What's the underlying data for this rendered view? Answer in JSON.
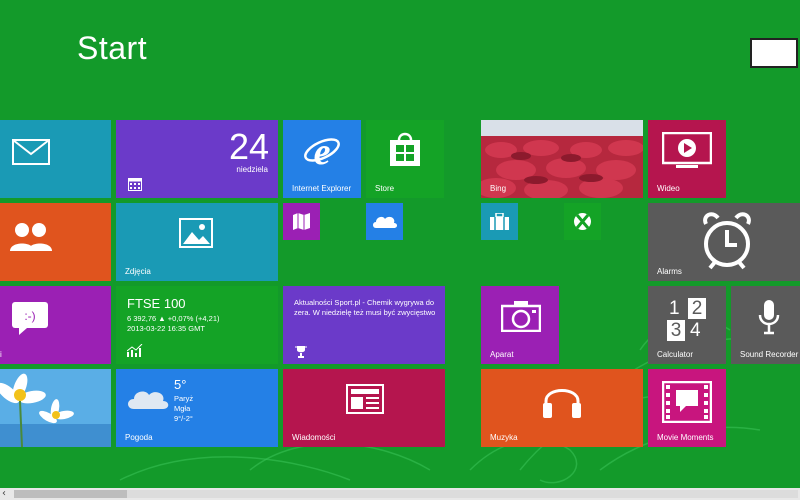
{
  "screen": {
    "title": "Start"
  },
  "colors": {
    "background": "#139a2a",
    "teal": "#1a9ab5",
    "orange": "#e0541e",
    "purple": "#9b20b4",
    "violet": "#6b3ac9",
    "blue": "#2480e6",
    "green": "#14a326",
    "magenta": "#b81b77",
    "crimson": "#b5154e",
    "gray": "#5a5a5a"
  },
  "tiles": {
    "mail": {
      "icon": "mail-icon"
    },
    "people": {
      "icon": "people-icon"
    },
    "messaging": {
      "icon": "messaging-icon",
      "label": "i"
    },
    "desktop": {
      "icon": "daisy-image"
    },
    "calendar": {
      "day_number": "24",
      "day_name": "niedziela",
      "icon": "calendar-icon"
    },
    "photos": {
      "label": "Zdjęcia",
      "icon": "photos-icon"
    },
    "finance": {
      "title": "FTSE 100",
      "line1": "6 392,76 ▲ +0,07% (+4,21)",
      "line2": "2013-03-22 16:35 GMT",
      "icon": "finance-chart-icon"
    },
    "weather": {
      "temperature": "5°",
      "city": "Paryż",
      "condition": "Mgła",
      "range": "9°/-2°",
      "label": "Pogoda",
      "icon": "cloud-icon"
    },
    "internet_explorer": {
      "label": "Internet Explorer",
      "icon": "ie-icon"
    },
    "store": {
      "label": "Store",
      "icon": "store-icon"
    },
    "maps": {
      "icon": "maps-icon"
    },
    "skydrive": {
      "icon": "skydrive-icon"
    },
    "sport": {
      "text": "Aktualności Sport.pl - Chemik wygrywa do zera. W niedzielę też musi być zwycięstwo",
      "icon": "trophy-icon"
    },
    "news": {
      "label": "Wiadomości",
      "icon": "news-icon"
    },
    "bing": {
      "label": "Bing",
      "icon": "bing-image"
    },
    "travel": {
      "icon": "travel-icon"
    },
    "games": {
      "icon": "xbox-icon"
    },
    "camera": {
      "label": "Aparat",
      "icon": "camera-icon"
    },
    "music": {
      "label": "Muzyka",
      "icon": "headphones-icon"
    },
    "video": {
      "label": "Wideo",
      "icon": "video-icon"
    },
    "alarms": {
      "label": "Alarms",
      "icon": "alarm-clock-icon"
    },
    "calculator": {
      "label": "Calculator",
      "icon": "calculator-icon",
      "digits": [
        "1",
        "2",
        "3",
        "4"
      ]
    },
    "sound_recorder": {
      "label": "Sound Recorder",
      "icon": "microphone-icon"
    },
    "movie_moments": {
      "label": "Movie Moments",
      "icon": "movie-moments-icon"
    }
  },
  "scrollbar": {
    "left_arrow": "‹"
  }
}
